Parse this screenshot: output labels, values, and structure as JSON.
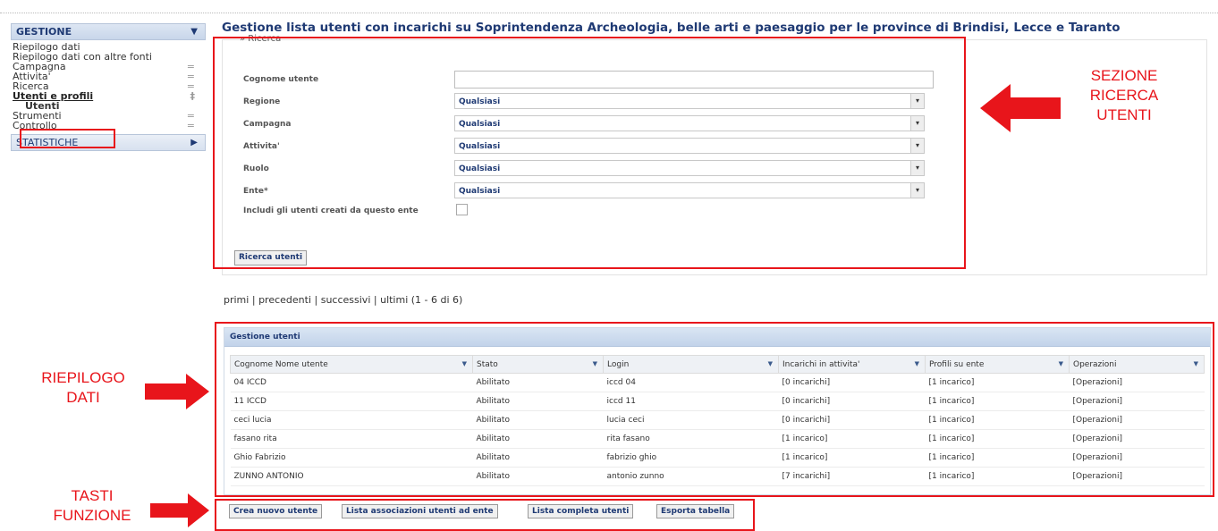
{
  "sidebar": {
    "gestione_label": "GESTIONE",
    "items": [
      {
        "label": "Riepilogo dati"
      },
      {
        "label": "Riepilogo dati con altre fonti"
      },
      {
        "label": "Campagna"
      },
      {
        "label": "Attivita'"
      },
      {
        "label": "Ricerca"
      },
      {
        "label": "Utenti e profili"
      },
      {
        "label": "Utenti"
      },
      {
        "label": "Strumenti"
      },
      {
        "label": "Controllo"
      }
    ],
    "statistiche_label": "STATISTICHE"
  },
  "page_title": "Gestione lista utenti con incarichi su Soprintendenza Archeologia, belle arti e paesaggio per le province di Brindisi, Lecce e Taranto",
  "search": {
    "section_label": "Ricerca",
    "cognome_label": "Cognome utente",
    "cognome_value": "",
    "regione_label": "Regione",
    "regione_value": "Qualsiasi",
    "campagna_label": "Campagna",
    "campagna_value": "Qualsiasi",
    "attivita_label": "Attivita'",
    "attivita_value": "Qualsiasi",
    "ruolo_label": "Ruolo",
    "ruolo_value": "Qualsiasi",
    "ente_label": "Ente*",
    "ente_value": "Qualsiasi",
    "includi_label": "Includi gli utenti creati da questo ente",
    "search_button": "Ricerca utenti"
  },
  "pager": {
    "primi": "primi",
    "sep": "|",
    "precedenti": "precedenti",
    "successivi": "successivi",
    "ultimi": "ultimi",
    "range": "(1 - 6 di 6)"
  },
  "table": {
    "caption": "Gestione utenti",
    "columns": [
      "Cognome Nome utente",
      "Stato",
      "Login",
      "Incarichi in attivita'",
      "Profili su ente",
      "Operazioni"
    ],
    "rows": [
      [
        "04 ICCD",
        "Abilitato",
        "iccd 04",
        "[0 incarichi]",
        "[1 incarico]",
        "[Operazioni]"
      ],
      [
        "11 ICCD",
        "Abilitato",
        "iccd 11",
        "[0 incarichi]",
        "[1 incarico]",
        "[Operazioni]"
      ],
      [
        "ceci lucia",
        "Abilitato",
        "lucia ceci",
        "[0 incarichi]",
        "[1 incarico]",
        "[Operazioni]"
      ],
      [
        "fasano rita",
        "Abilitato",
        "rita fasano",
        "[1 incarico]",
        "[1 incarico]",
        "[Operazioni]"
      ],
      [
        "Ghio Fabrizio",
        "Abilitato",
        "fabrizio ghio",
        "[1 incarico]",
        "[1 incarico]",
        "[Operazioni]"
      ],
      [
        "ZUNNO ANTONIO",
        "Abilitato",
        "antonio zunno",
        "[7 incarichi]",
        "[1 incarico]",
        "[Operazioni]"
      ]
    ]
  },
  "buttons": {
    "crea": "Crea nuovo utente",
    "lista_assoc": "Lista associazioni utenti ad ente",
    "lista_completa": "Lista completa utenti",
    "esporta": "Esporta tabella"
  },
  "annotations": {
    "sezione_ricerca": [
      "SEZIONE",
      "RICERCA",
      "UTENTI"
    ],
    "riepilogo": [
      "RIEPILOGO",
      "DATI"
    ],
    "tasti": [
      "TASTI",
      "FUNZIONE"
    ]
  },
  "colors": {
    "annotation_red": "#e8151b",
    "brand_blue": "#1f3a74"
  }
}
